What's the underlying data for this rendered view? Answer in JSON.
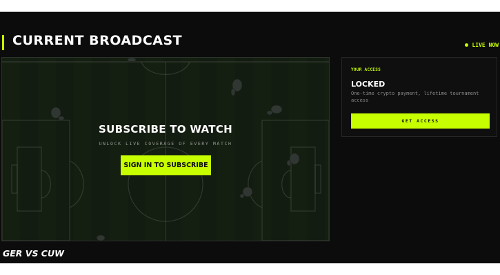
{
  "header": {
    "title": "CURRENT BROADCAST",
    "live_label": "LIVE NOW"
  },
  "player": {
    "overlay_title": "SUBSCRIBE TO WATCH",
    "overlay_subtitle": "UNLOCK LIVE COVERAGE OF EVERY MATCH",
    "sign_in_label": "SIGN IN TO SUBSCRIBE"
  },
  "match": {
    "title": "GER VS CUW"
  },
  "access": {
    "label": "YOUR ACCESS",
    "status": "LOCKED",
    "description": "One-time crypto payment, lifetime tournament access",
    "button_label": "GET ACCESS"
  },
  "colors": {
    "accent": "#c8ff00",
    "background": "#0c0c0c",
    "pitch": "#1c2a18"
  }
}
